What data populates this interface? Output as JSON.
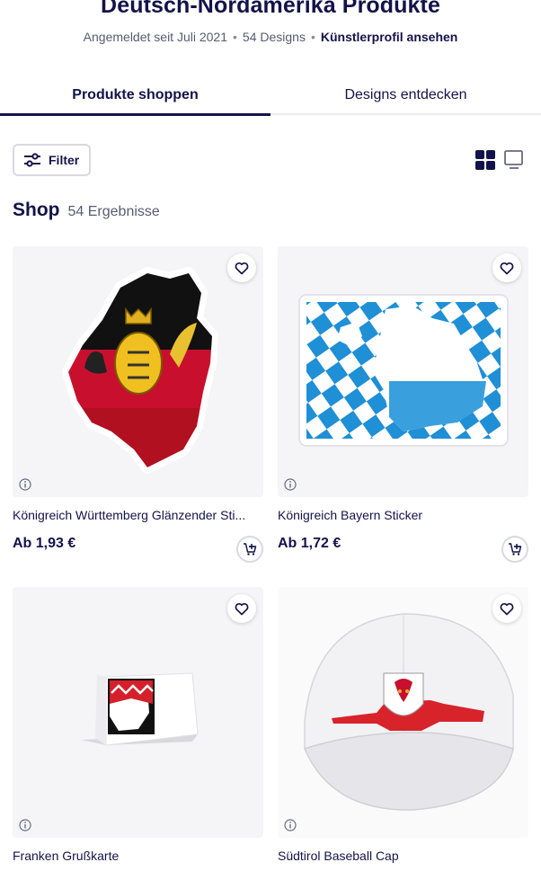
{
  "header": {
    "title": "Deutsch-Nordamerika Produkte",
    "member_since": "Angemeldet seit Juli 2021",
    "designs_count": "54 Designs",
    "profile_link": "Künstlerprofil ansehen"
  },
  "tabs": [
    {
      "label": "Produkte shoppen",
      "active": true
    },
    {
      "label": "Designs entdecken",
      "active": false
    }
  ],
  "toolbar": {
    "filter_label": "Filter",
    "view_grid_icon": "grid-view-icon",
    "view_list_icon": "list-view-icon"
  },
  "shop": {
    "title": "Shop",
    "results": "54 Ergebnisse"
  },
  "products": [
    {
      "name": "Königreich Württemberg Glänzender Sti...",
      "price": "Ab 1,93 €"
    },
    {
      "name": "Königreich Bayern Sticker",
      "price": "Ab 1,72 €"
    },
    {
      "name": "Franken Grußkarte"
    },
    {
      "name": "Südtirol Baseball Cap"
    }
  ],
  "colors": {
    "text_primary": "#13134a",
    "text_secondary": "#5a5a72",
    "card_background": "#f5f5f7",
    "border": "#d9d9e2"
  }
}
